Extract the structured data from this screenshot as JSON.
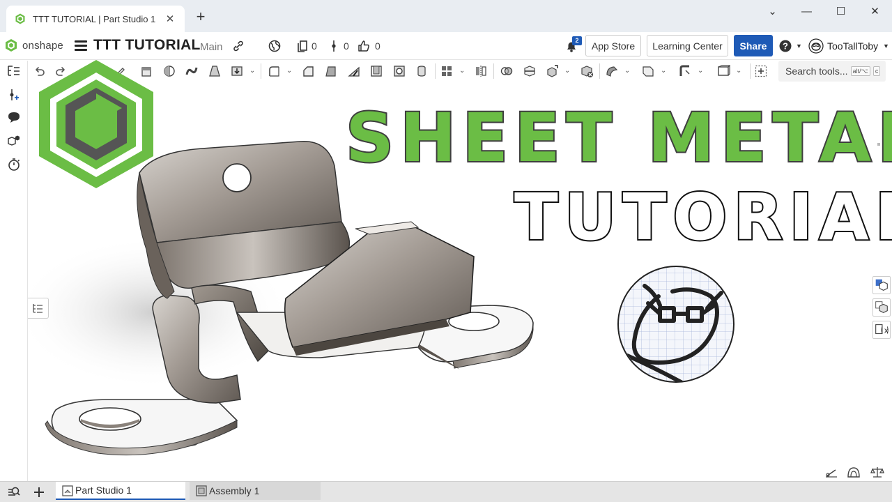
{
  "browser": {
    "tab_title": "TTT TUTORIAL | Part Studio 1",
    "new_tab_label": "+",
    "close_label": "✕",
    "window_controls": {
      "minimize": "—",
      "maximize": "☐",
      "close": "✕",
      "tabs_menu": "⌄"
    }
  },
  "header": {
    "brand": "onshape",
    "document_name": "TTT TUTORIAL",
    "branch": "Main",
    "versions_count": "0",
    "workflow_count": "0",
    "likes_count": "0",
    "notification_count": "2",
    "app_store_label": "App Store",
    "learning_center_label": "Learning Center",
    "share_label": "Share",
    "username": "TooTallToby"
  },
  "toolbar": {
    "search_placeholder": "Search tools...",
    "search_shortcut_1": "alt/⌥",
    "search_shortcut_2": "c"
  },
  "overlay": {
    "title_line1": "SHEET METAL",
    "title_line2": "TUTORIAL"
  },
  "colors": {
    "onshape_green": "#6bbd45",
    "share_blue": "#1e5ab6",
    "logo_dark": "#555555"
  },
  "bottom_tabs": [
    {
      "label": "Part Studio 1",
      "active": true
    },
    {
      "label": "Assembly 1",
      "active": false
    }
  ]
}
